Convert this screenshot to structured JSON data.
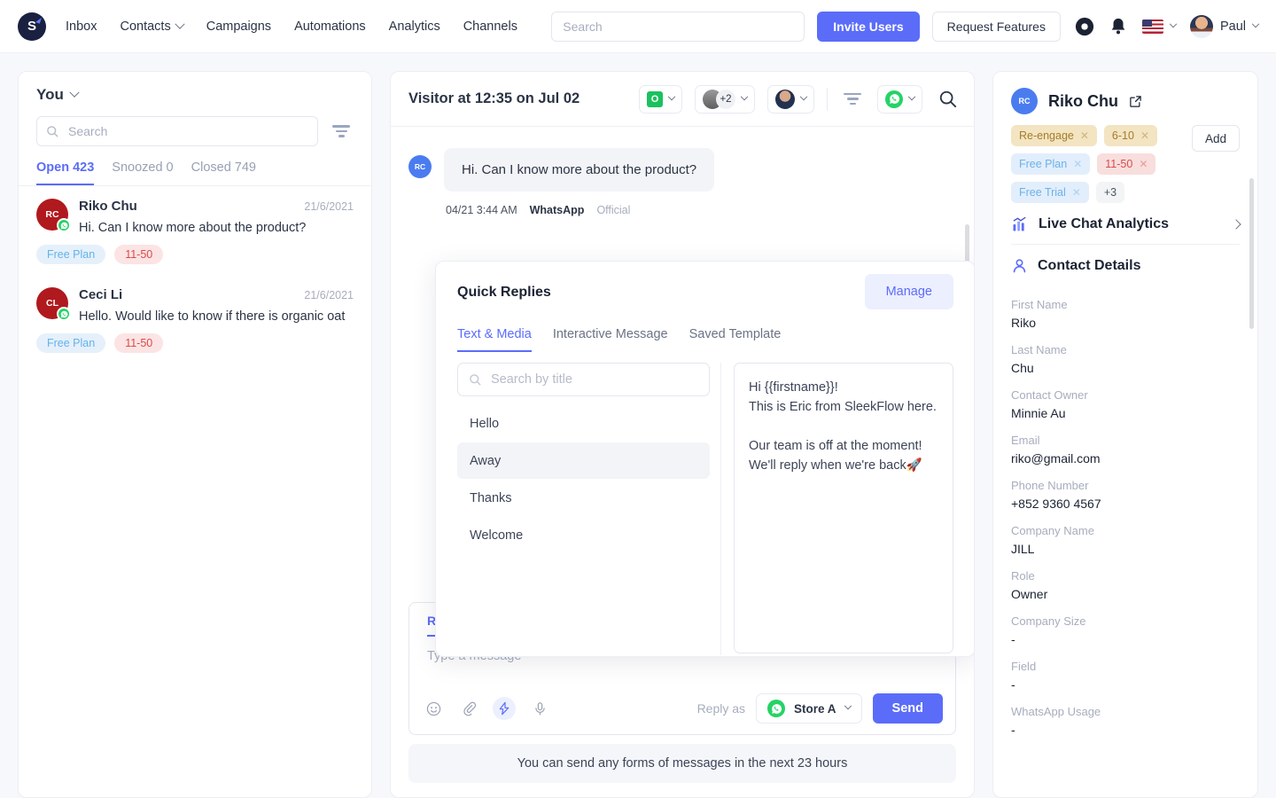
{
  "topnav": {
    "logo_letter": "S",
    "links": [
      {
        "label": "Inbox",
        "has_caret": false
      },
      {
        "label": "Contacts",
        "has_caret": true
      },
      {
        "label": "Campaigns",
        "has_caret": false
      },
      {
        "label": "Automations",
        "has_caret": false
      },
      {
        "label": "Analytics",
        "has_caret": false
      },
      {
        "label": "Channels",
        "has_caret": false
      }
    ],
    "search_placeholder": "Search",
    "invite_users_label": "Invite Users",
    "request_features_label": "Request Features",
    "settings_icon": "gear-icon",
    "notification_icon": "bell-icon",
    "language_flag": "us-flag-icon",
    "user_name": "Paul"
  },
  "sidebar": {
    "inbox_owner": "You",
    "search_placeholder": "Search",
    "filter_icon": "filter-icon",
    "tabs": [
      {
        "label": "Open 423",
        "active": true
      },
      {
        "label": "Snoozed 0",
        "active": false
      },
      {
        "label": "Closed 749",
        "active": false
      }
    ],
    "conversations": [
      {
        "initials": "RC",
        "name": "Riko Chu",
        "date": "21/6/2021",
        "preview": "Hi. Can I know more about the product?",
        "channel_icon": "whatsapp-icon",
        "chips": [
          {
            "label": "Free Plan",
            "style": "blue"
          },
          {
            "label": "11-50",
            "style": "pink"
          }
        ]
      },
      {
        "initials": "CL",
        "name": "Ceci Li",
        "date": "21/6/2021",
        "preview": "Hello. Would like to know if there is organic oat",
        "channel_icon": "whatsapp-icon",
        "chips": [
          {
            "label": "Free Plan",
            "style": "blue"
          },
          {
            "label": "11-50",
            "style": "pink"
          }
        ]
      }
    ]
  },
  "conversation": {
    "title": "Visitor at 12:35 on Jul 02",
    "status_badge": "O",
    "assignee_count": "+2",
    "filter_icon": "filter-icon",
    "channel_icon": "whatsapp-icon",
    "search_icon": "search-icon",
    "messages": [
      {
        "initials": "RC",
        "text": "Hi. Can I know more about the product?",
        "time": "04/21 3:44 AM",
        "channel": "WhatsApp",
        "tag": "Official"
      }
    ],
    "notice": "You can send any forms of messages in the next 23 hours"
  },
  "composer": {
    "tab_label": "Reply",
    "placeholder": "Type a message",
    "icons": [
      "emoji-icon",
      "attachment-icon",
      "lightning-icon",
      "microphone-icon"
    ],
    "reply_as_label": "Reply as",
    "channel_name": "Store A",
    "send_label": "Send"
  },
  "quick_replies": {
    "title": "Quick Replies",
    "manage_label": "Manage",
    "tabs": [
      {
        "label": "Text & Media",
        "active": true
      },
      {
        "label": "Interactive Message",
        "active": false
      },
      {
        "label": "Saved Template",
        "active": false
      }
    ],
    "search_placeholder": "Search by title",
    "items": [
      {
        "label": "Hello",
        "selected": false
      },
      {
        "label": "Away",
        "selected": true
      },
      {
        "label": "Thanks",
        "selected": false
      },
      {
        "label": "Welcome",
        "selected": false
      }
    ],
    "preview": "Hi {{firstname}}!\nThis is Eric from SleekFlow here.\n\nOur team is off at the moment!\nWe'll reply when we're back🚀"
  },
  "contact_panel": {
    "initials": "RC",
    "name": "Riko Chu",
    "open_icon": "external-link-icon",
    "add_label": "Add",
    "tags": [
      {
        "label": "Re-engage",
        "style": "tan",
        "removable": true
      },
      {
        "label": "6-10",
        "style": "tan",
        "removable": true
      },
      {
        "label": "Free Plan",
        "style": "lblue",
        "removable": true
      },
      {
        "label": "11-50",
        "style": "rose",
        "removable": true
      },
      {
        "label": "Free Trial",
        "style": "lblue",
        "removable": true
      },
      {
        "label": "+3",
        "style": "gray",
        "removable": false
      }
    ],
    "analytics_label": "Live Chat Analytics",
    "analytics_icon": "bar-chart-icon",
    "details_label": "Contact Details",
    "details_icon": "person-icon",
    "fields": [
      {
        "label": "First Name",
        "value": "Riko"
      },
      {
        "label": "Last Name",
        "value": "Chu"
      },
      {
        "label": "Contact Owner",
        "value": "Minnie Au"
      },
      {
        "label": "Email",
        "value": "riko@gmail.com"
      },
      {
        "label": "Phone Number",
        "value": "+852 9360 4567"
      },
      {
        "label": "Company Name",
        "value": "JILL"
      },
      {
        "label": "Role",
        "value": "Owner"
      },
      {
        "label": "Company Size",
        "value": "-"
      },
      {
        "label": "Field",
        "value": "-"
      },
      {
        "label": "WhatsApp Usage",
        "value": "-"
      }
    ]
  },
  "colors": {
    "accent": "#5b6cf9",
    "whatsapp_green": "#25d366",
    "status_green": "#1cc15f",
    "avatar_red": "#b0191d",
    "avatar_blue": "#4a7cf0"
  }
}
